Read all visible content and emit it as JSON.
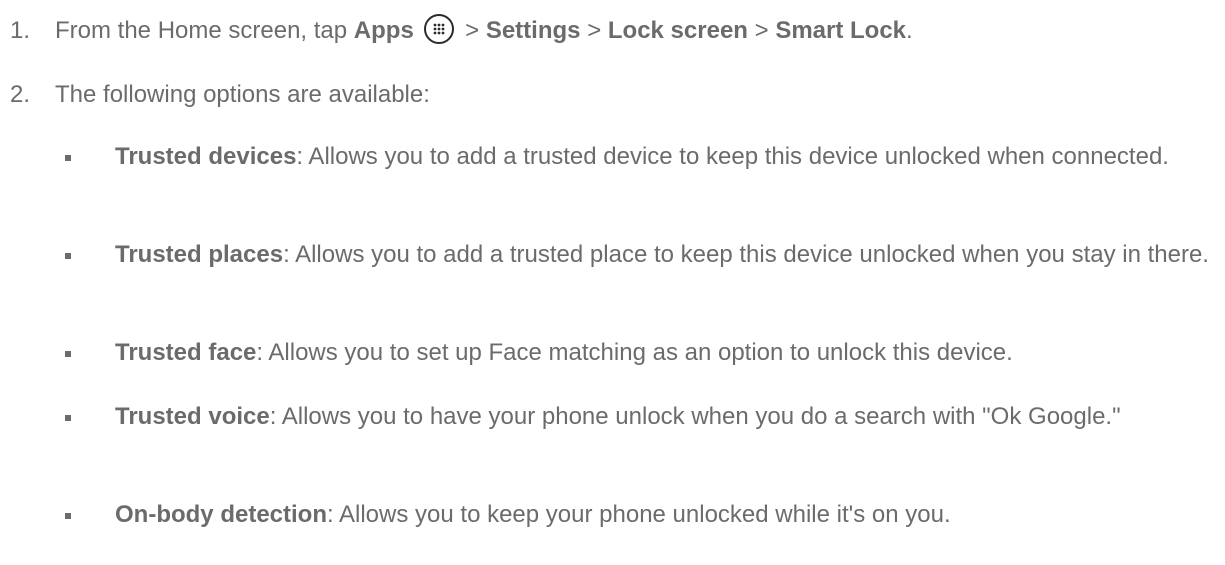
{
  "step1": {
    "number": "1.",
    "prefix": "From the Home screen, tap",
    "apps": "Apps",
    "sep1": ">",
    "settings": "Settings",
    "sep2": ">",
    "lock_screen": "Lock screen",
    "sep3": ">",
    "smart_lock": "Smart Lock",
    "end": "."
  },
  "step2": {
    "number": "2.",
    "text": "The following options are available:"
  },
  "options": [
    {
      "term": "Trusted devices",
      "desc": ": Allows you to add a trusted device to keep this device unlocked when connected."
    },
    {
      "term": "Trusted places",
      "desc": ": Allows you to add a trusted place to keep this device unlocked when you stay in there."
    },
    {
      "term": "Trusted face",
      "desc": ": Allows you to set up Face matching as an option to unlock this device."
    },
    {
      "term": "Trusted voice",
      "desc": ": Allows you to have your phone unlock when you do a search with \"Ok Google.\""
    },
    {
      "term": "On-body detection",
      "desc": ": Allows you to keep your phone unlocked while it's on you."
    }
  ],
  "icons": {
    "apps": "apps-grid-icon"
  }
}
